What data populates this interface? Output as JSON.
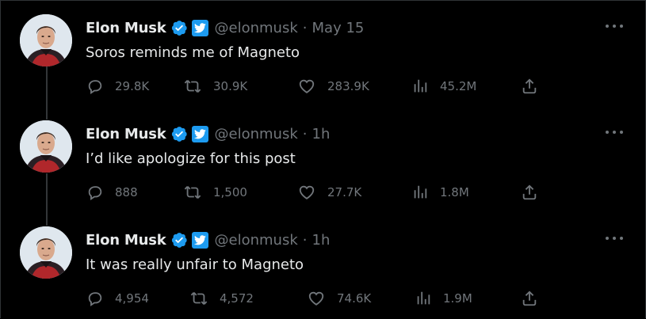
{
  "colors": {
    "background": "#000000",
    "text_primary": "#e7e9ea",
    "text_secondary": "#71767b",
    "verified_blue": "#1d9bf0",
    "thread_line": "#333639"
  },
  "tweets": [
    {
      "author": {
        "name": "Elon Musk",
        "handle": "@elonmusk",
        "verified_icon": "verified-badge-icon",
        "app_badge_icon": "twitter-bird-icon"
      },
      "separator": "·",
      "time": "May 15",
      "text": "Soros reminds me of Magneto",
      "actions": {
        "replies": "29.8K",
        "retweets": "30.9K",
        "likes": "283.9K",
        "views": "45.2M"
      }
    },
    {
      "author": {
        "name": "Elon Musk",
        "handle": "@elonmusk",
        "verified_icon": "verified-badge-icon",
        "app_badge_icon": "twitter-bird-icon"
      },
      "separator": "·",
      "time": "1h",
      "text": "I’d like apologize for this post",
      "actions": {
        "replies": "888",
        "retweets": "1,500",
        "likes": "27.7K",
        "views": "1.8M"
      }
    },
    {
      "author": {
        "name": "Elon Musk",
        "handle": "@elonmusk",
        "verified_icon": "verified-badge-icon",
        "app_badge_icon": "twitter-bird-icon"
      },
      "separator": "·",
      "time": "1h",
      "text": "It was really unfair to Magneto",
      "actions": {
        "replies": "4,954",
        "retweets": "4,572",
        "likes": "74.6K",
        "views": "1.9M"
      }
    }
  ],
  "icons": {
    "more": "more-options-icon",
    "reply": "reply-icon",
    "retweet": "retweet-icon",
    "like": "heart-icon",
    "views": "views-chart-icon",
    "share": "share-icon"
  }
}
